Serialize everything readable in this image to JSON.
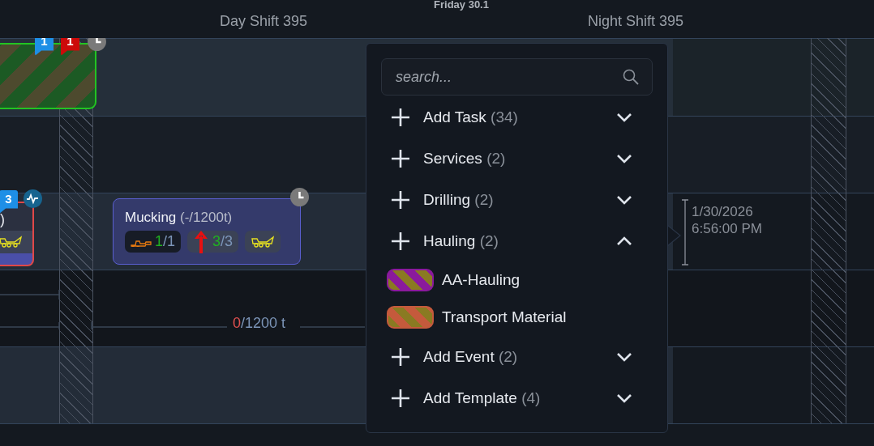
{
  "header": {
    "date": "Friday 30.1",
    "shifts": [
      "Day Shift 395",
      "Night Shift 395"
    ]
  },
  "timeline": {
    "tasks": [
      {
        "kind": "hatched",
        "badges": [
          {
            "text": "1",
            "color": "#1e8fe6"
          },
          {
            "text": "1",
            "color": "#cc0a0a"
          }
        ]
      },
      {
        "kind": "partial",
        "title": ")",
        "badges": [
          {
            "text": "3",
            "color": "#1e8fe6"
          }
        ]
      },
      {
        "kind": "card",
        "title": "Mucking",
        "subtitle": "(-/1200t)",
        "resources": [
          {
            "kind": "loader",
            "done": "1",
            "total": "/1"
          },
          {
            "kind": "drill",
            "done": "3",
            "total": "/3"
          },
          {
            "kind": "truck"
          }
        ]
      }
    ],
    "summary": {
      "actual": "0",
      "target": "/1200 t"
    },
    "marker": {
      "date": "1/30/2026",
      "time": "6:56:00 PM"
    }
  },
  "menu": {
    "search": {
      "placeholder": "search..."
    },
    "groups": [
      {
        "label": "Add Task",
        "count": "(34)",
        "expanded": false
      },
      {
        "label": "Services",
        "count": "(2)",
        "expanded": false
      },
      {
        "label": "Drilling",
        "count": "(2)",
        "expanded": false
      },
      {
        "label": "Hauling",
        "count": "(2)",
        "expanded": true,
        "children": [
          {
            "label": "AA-Hauling",
            "color": "#8a1a9c"
          },
          {
            "label": "Transport Material",
            "color": "#c55a3c"
          }
        ]
      },
      {
        "label": "Add Event",
        "count": "(2)",
        "expanded": false
      },
      {
        "label": "Add Template",
        "count": "(4)",
        "expanded": false
      }
    ]
  }
}
